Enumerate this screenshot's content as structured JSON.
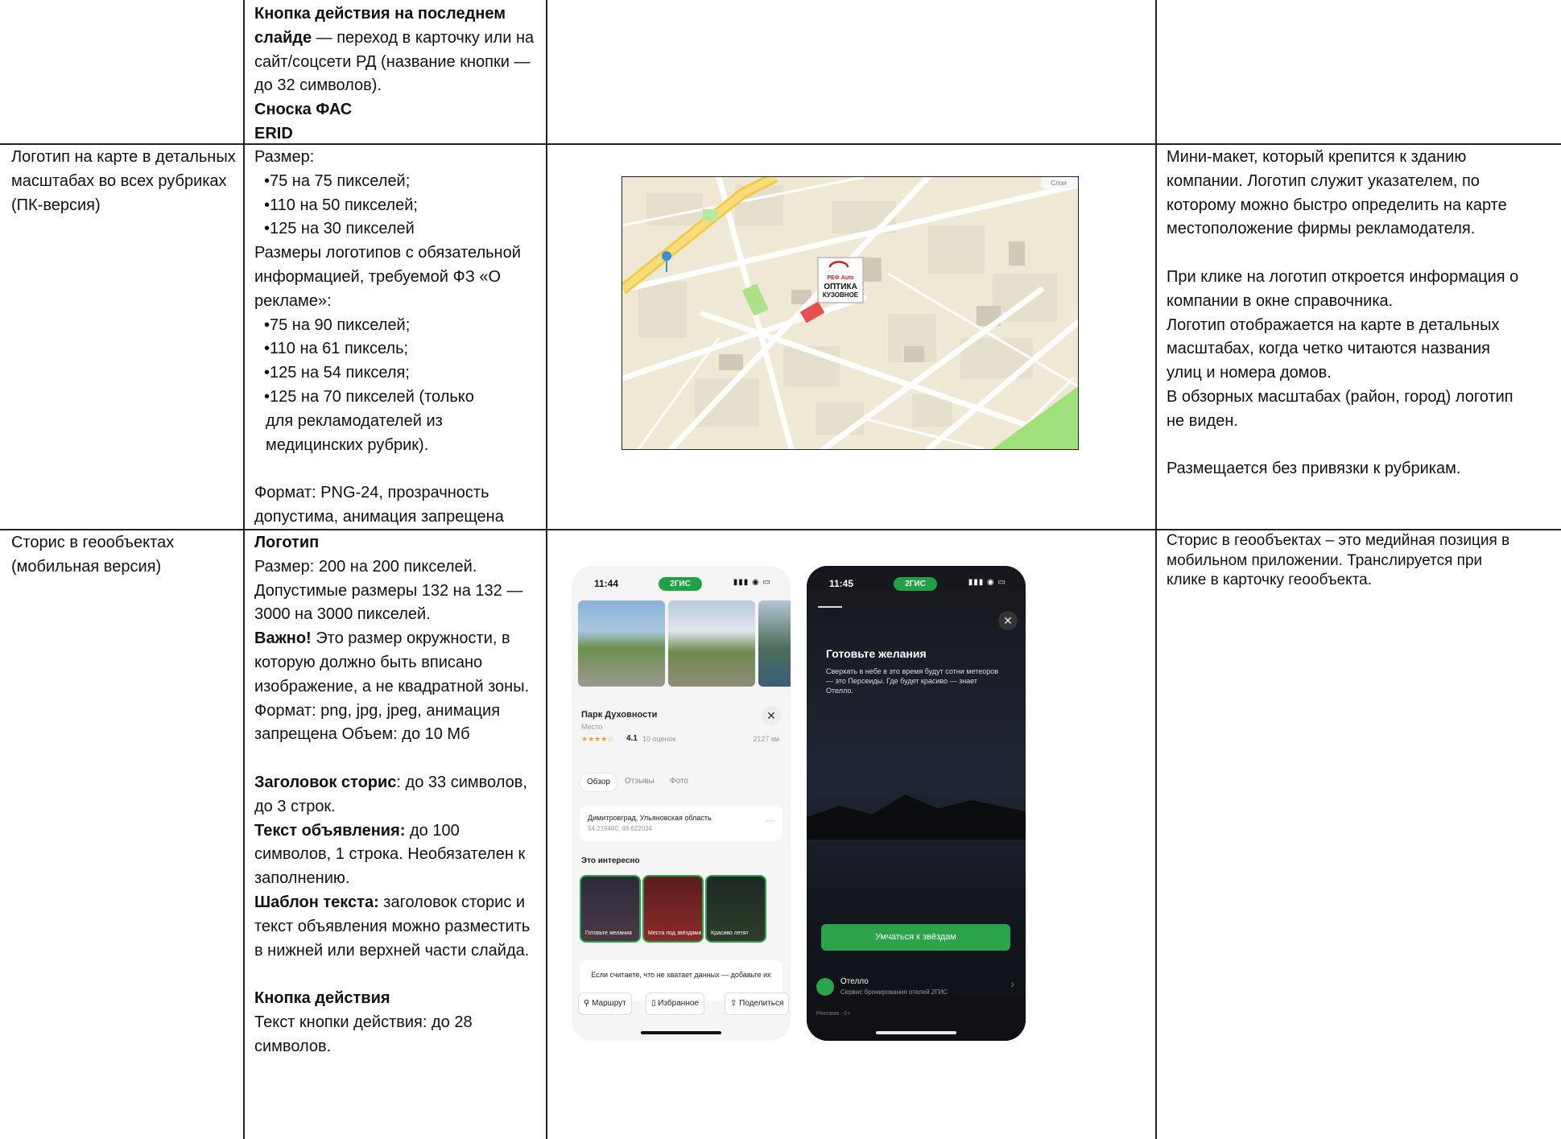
{
  "row1": {
    "col2": {
      "p1_bold": "Кнопка действия на последнем слайде",
      "p1_rest": " —  переход в карточку или на сайт/соцсети РД (название кнопки — до 32 символов).",
      "fas": "Сноска ФАС",
      "erid": "ERID"
    }
  },
  "row2": {
    "col1": "Логотип на карте в детальных масштабах во всех рубриках (ПК-версия)",
    "col2": {
      "size_label": "Размер:",
      "sizes": [
        "•75 на 75 пикселей;",
        "•110 на 50 пикселей;",
        "•125 на 30 пикселей"
      ],
      "req_text": "Размеры логотипов с обязательной информацией, требуемой ФЗ «О рекламе»:",
      "req_sizes": [
        "•75 на 90 пикселей;",
        "•110 на 61 пиксель;",
        "•125 на 54 пикселя;",
        "•125 на 70 пикселей (только"
      ],
      "req_note": "для рекламодателей из медицинских рубрик).",
      "format": "Формат: PNG-24, прозрачность допустима, анимация запрещена"
    },
    "map": {
      "logo_line1": "РЕФ Auto",
      "logo_line2": "ОПТИКА",
      "logo_line3": "КУЗОВНОЕ",
      "corner": "Слои"
    },
    "col4": {
      "p1": "Мини-макет, который крепится к зданию компании. Логотип служит указателем, по которому можно быстро определить на карте местоположение фирмы рекламодателя.",
      "p2": "При клике на логотип откроется информация о компании в окне справочника.",
      "p3": "Логотип отображается на карте в детальных масштабах, когда четко читаются названия улиц и номера домов.",
      "p4": "В обзорных масштабах (район, город) логотип не виден.",
      "p5": "Размещается без привязки к рубрикам."
    }
  },
  "row3": {
    "col1": "Сторис в геообъектах (мобильная версия)",
    "col2": {
      "logo_h": "Логотип",
      "logo_t1": "Размер: 200 на 200 пикселей. Допустимые размеры 132 на 132 — 3000 на 3000 пикселей.",
      "important": "Важно!",
      "important_rest": " Это размер окружности, в которую должно быть вписано изображение, а не квадратной зоны.",
      "format": "Формат: png, jpg, jpeg, анимация запрещена Объем: до 10 Мб",
      "title_h": "Заголовок сторис",
      "title_t": ": до 33 символов, до 3 строк.",
      "ad_h": "Текст объявления:",
      "ad_t": " до 100 символов, 1 строка. Необязателен к заполнению.",
      "tpl_h": "Шаблон текста:",
      "tpl_t": " заголовок сторис и текст объявления можно разместить в нижней или верхней части слайда.",
      "btn_h": "Кнопка действия",
      "btn_t": "Текст кнопки действия: до 28 символов."
    },
    "col4": "Сторис в геообъектах – это медийная позиция в мобильном приложении. Транслируется при клике в карточку геообъекта.",
    "phone_left": {
      "time": "11:44",
      "brand": "2ГИС",
      "place": "Парк Духовности",
      "type": "Место",
      "rating": "4.1",
      "reviews": "10 оценок",
      "distance": "2127 км",
      "tabs": [
        "Обзор",
        "Отзывы",
        "Фото"
      ],
      "address": "Димитровград, Ульяновская область",
      "coords": "54.219460, 49.622034",
      "interesting": "Это интересно",
      "thumbs": [
        "Готовьте желания",
        "Места под звёздами",
        "Красиво летят"
      ],
      "missing": "Если считаете, что не хватает данных — добавьте их",
      "actions": [
        "Маршрут",
        "Избранное",
        "Поделиться"
      ]
    },
    "phone_right": {
      "time": "11:45",
      "brand": "2ГИС",
      "title": "Готовьте желания",
      "text": "Сверкать в небе в это время будут сотни метеоров — это Персеиды. Где будет красиво — знает Отелло.",
      "button": "Умчаться к звёздам",
      "brand_name": "Отелло",
      "brand_sub": "Сервис бронирования отелей 2ГИС",
      "ad_label": "Реклама · 0+"
    }
  }
}
